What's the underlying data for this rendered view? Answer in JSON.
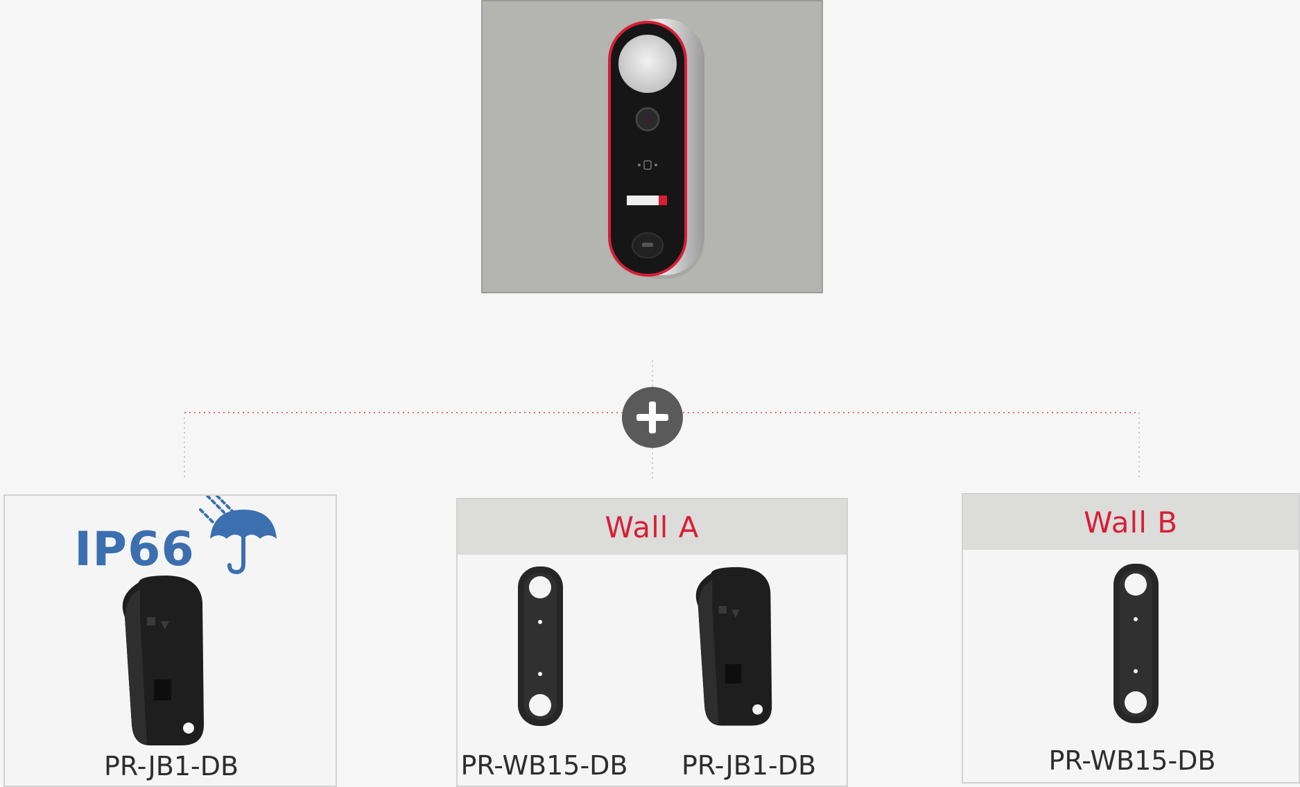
{
  "badge": {
    "ip_rating": "IP66"
  },
  "panels": {
    "left": {
      "label": "PR-JB1-DB"
    },
    "wall_a": {
      "title": "Wall A",
      "label_1": "PR-WB15-DB",
      "label_2": "PR-JB1-DB"
    },
    "wall_b": {
      "title": "Wall B",
      "label": "PR-WB15-DB"
    }
  },
  "colors": {
    "accent_red": "#d61f36",
    "ip_blue": "#3b6fb0",
    "plus_gray": "#5a5a5a"
  }
}
